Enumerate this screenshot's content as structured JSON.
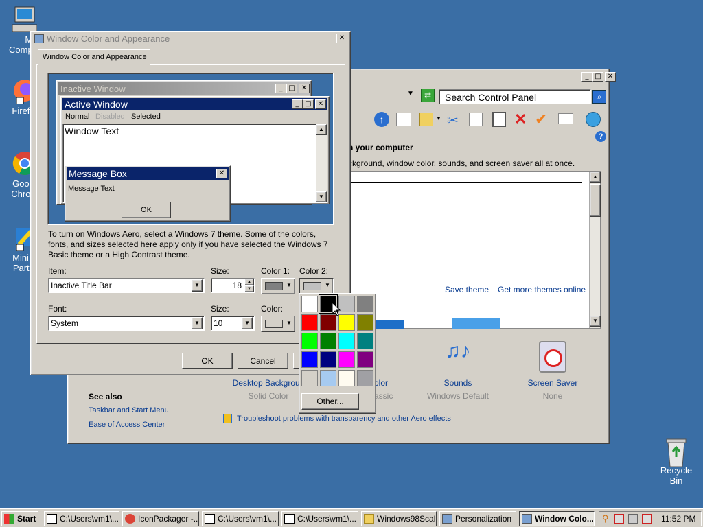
{
  "desktop": {
    "icons": [
      {
        "label_line1": "My",
        "label_line2": "Compu"
      },
      {
        "label_line1": "Firefo",
        "label_line2": ""
      },
      {
        "label_line1": "Goog",
        "label_line2": "Chron"
      },
      {
        "label_line1": "MiniT",
        "label_line2": "Partit"
      },
      {
        "label_line1": "Recycle",
        "label_line2": "Bin"
      }
    ]
  },
  "control_panel": {
    "search_placeholder": "Search Control Panel",
    "heading": "n your computer",
    "description": "ckground, window color, sounds, and screen saver all at once.",
    "save_theme": "Save theme",
    "get_more_themes": "Get more themes online",
    "bottom_items": [
      {
        "label": "Desktop Backgroun",
        "sub": "Solid Color"
      },
      {
        "label": "olor",
        "sub": "assic"
      },
      {
        "label": "Sounds",
        "sub": "Windows Default"
      },
      {
        "label": "Screen Saver",
        "sub": "None"
      }
    ],
    "see_also": "See also",
    "see_also_links": [
      "Taskbar and Start Menu",
      "Ease of Access Center"
    ],
    "troubleshoot": "Troubleshoot problems with transparency and other Aero effects"
  },
  "dialog": {
    "title": "Window Color and Appearance",
    "tab": "Window Color and Appearance",
    "preview": {
      "inactive_title": "Inactive Window",
      "active_title": "Active Window",
      "menu_normal": "Normal",
      "menu_disabled": "Disabled",
      "menu_selected": "Selected",
      "window_text": "Window Text",
      "msgbox_title": "Message Box",
      "msgbox_text": "Message Text",
      "msgbox_ok": "OK"
    },
    "info_text": "To turn on Windows Aero, select a Windows 7 theme.  Some of the colors, fonts, and sizes selected here apply only if you have selected the Windows 7 Basic theme or a High Contrast theme.",
    "item_label": "Item:",
    "item_value": "Inactive Title Bar",
    "size_label": "Size:",
    "size_value": "18",
    "color1_label": "Color 1:",
    "color2_label": "Color 2:",
    "font_label": "Font:",
    "font_value": "System",
    "font_size_label": "Size:",
    "font_size_value": "10",
    "font_color_label": "Color:",
    "ok": "OK",
    "cancel": "Cancel"
  },
  "color_popup": {
    "colors": [
      "#ffffff",
      "#000000",
      "#c0c0c0",
      "#808080",
      "#ff0000",
      "#800000",
      "#ffff00",
      "#808000",
      "#00ff00",
      "#008000",
      "#00ffff",
      "#008080",
      "#0000ff",
      "#000080",
      "#ff00ff",
      "#800080",
      "#d4d0c8",
      "#a6caf0",
      "#fffbf0",
      "#a0a0a4"
    ],
    "other": "Other..."
  },
  "taskbar": {
    "start": "Start",
    "tasks": [
      "C:\\Users\\vm1\\...",
      "IconPackager -...",
      "C:\\Users\\vm1\\...",
      "C:\\Users\\vm1\\...",
      "Windows98Scal...",
      "Personalization",
      "Window Colo..."
    ],
    "clock": "11:52 PM"
  }
}
